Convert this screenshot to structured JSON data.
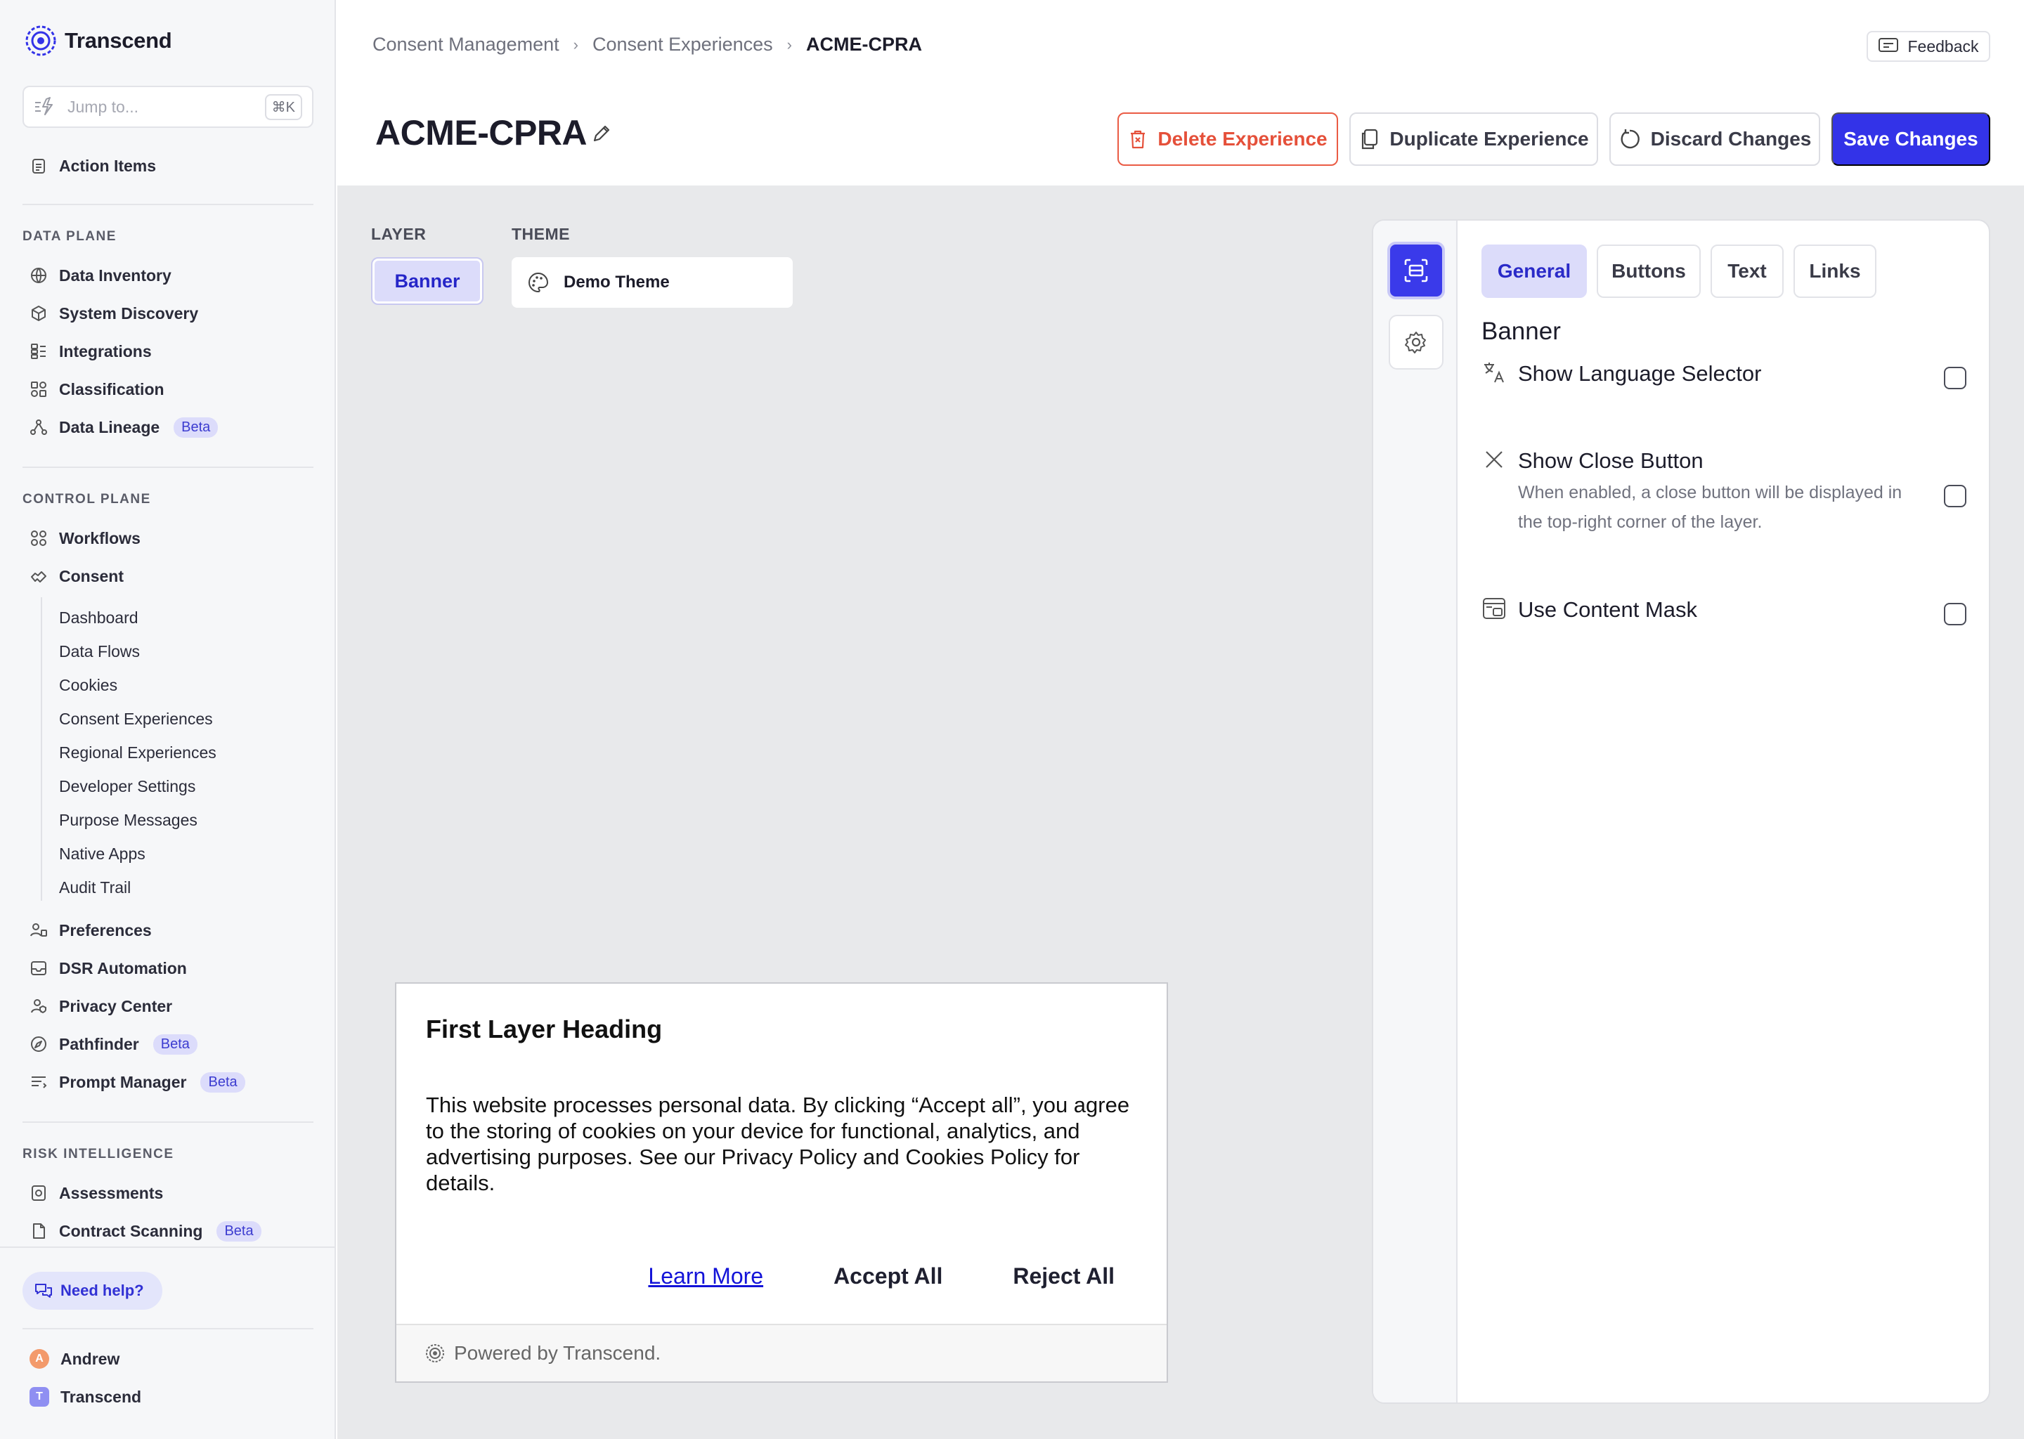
{
  "app": {
    "name": "Transcend"
  },
  "sidebar": {
    "jump_placeholder": "Jump to...",
    "jump_shortcut": "⌘K",
    "top_item": "Action Items",
    "sections": {
      "data_plane": "DATA PLANE",
      "control_plane": "CONTROL PLANE",
      "risk_intelligence": "RISK INTELLIGENCE"
    },
    "data_plane_items": [
      "Data Inventory",
      "System Discovery",
      "Integrations",
      "Classification",
      "Data Lineage"
    ],
    "control_plane_items": [
      "Workflows",
      "Consent",
      "Preferences",
      "DSR Automation",
      "Privacy Center",
      "Pathfinder",
      "Prompt Manager"
    ],
    "consent_sub_items": [
      "Dashboard",
      "Data Flows",
      "Cookies",
      "Consent Experiences",
      "Regional Experiences",
      "Developer Settings",
      "Purpose Messages",
      "Native Apps",
      "Audit Trail"
    ],
    "risk_items": [
      "Assessments",
      "Contract Scanning"
    ],
    "beta_label": "Beta",
    "help_label": "Need help?",
    "user_name": "Andrew",
    "user_initial": "A",
    "org_name": "Transcend",
    "org_initial": "T"
  },
  "header": {
    "breadcrumb": [
      "Consent Management",
      "Consent Experiences",
      "ACME-CPRA"
    ],
    "feedback_label": "Feedback",
    "title": "ACME-CPRA",
    "delete_label": "Delete Experience",
    "duplicate_label": "Duplicate Experience",
    "discard_label": "Discard Changes",
    "save_label": "Save Changes"
  },
  "editor": {
    "layer_label": "LAYER",
    "layer_value": "Banner",
    "theme_label": "THEME",
    "theme_value": "Demo Theme"
  },
  "preview": {
    "heading": "First Layer Heading",
    "body": "This website processes personal data. By clicking “Accept all”, you agree to the storing of cookies on your device for functional, analytics, and advertising purposes. See our Privacy Policy and Cookies Policy for details.",
    "learn_more": "Learn More",
    "accept_all": "Accept All",
    "reject_all": "Reject All",
    "powered_by": "Powered by Transcend."
  },
  "panel": {
    "tabs": [
      "General",
      "Buttons",
      "Text",
      "Links"
    ],
    "active_tab": "General",
    "heading": "Banner",
    "options": [
      {
        "title": "Show Language Selector",
        "description": "",
        "checked": false
      },
      {
        "title": "Show Close Button",
        "description": "When enabled, a close button will be displayed in the top-right corner of the layer.",
        "checked": false
      },
      {
        "title": "Use Content Mask",
        "description": "",
        "checked": false
      }
    ]
  },
  "colors": {
    "accent": "#3333e8",
    "danger": "#e5503a",
    "beta_bg": "#dcdcfb"
  }
}
